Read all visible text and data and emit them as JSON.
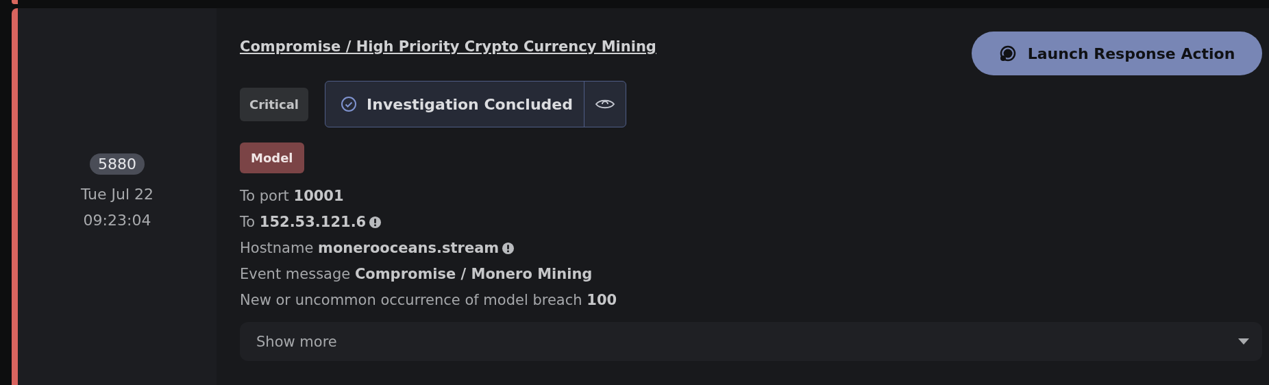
{
  "incident": {
    "id": "5880",
    "date": "Tue Jul 22",
    "time": "09:23:04"
  },
  "title": "Compromise / High Priority Crypto Currency Mining",
  "action_button": {
    "label": "Launch Response Action"
  },
  "severity": "Critical",
  "status": {
    "label": "Investigation Concluded"
  },
  "tag": "Model",
  "details": [
    {
      "label": "To port",
      "value": "10001",
      "flagged": false
    },
    {
      "label": "To",
      "value": "152.53.121.6",
      "flagged": true
    },
    {
      "label": "Hostname",
      "value": "monerooceans.stream",
      "flagged": true
    },
    {
      "label": "Event message",
      "value": "Compromise / Monero Mining",
      "flagged": false
    },
    {
      "label": "New or uncommon occurrence of model breach",
      "value": "100",
      "flagged": false
    }
  ],
  "show_more": {
    "label": "Show more",
    "expanded": false
  }
}
